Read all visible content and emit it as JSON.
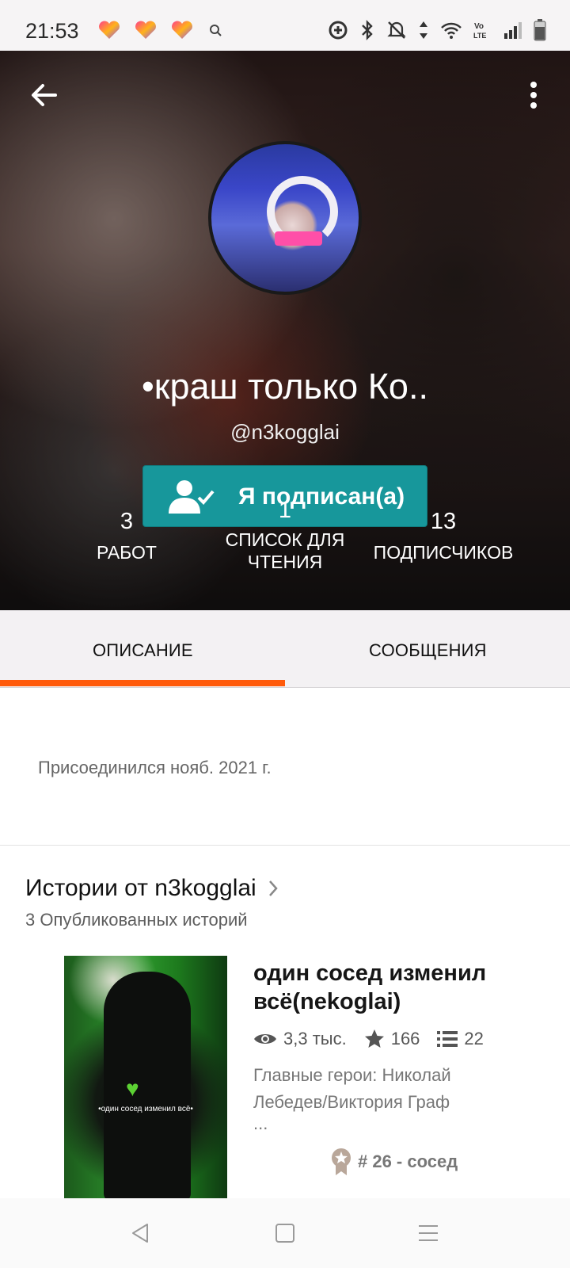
{
  "status_bar": {
    "time": "21:53",
    "app_icons": [
      "likee-heart-icon",
      "likee-heart-icon",
      "likee-heart-icon",
      "search-icon"
    ],
    "system_icons": [
      "data-saver-icon",
      "bluetooth-icon",
      "mute-icon",
      "data-arrows-icon",
      "wifi-icon",
      "volte-icon",
      "signal-icon",
      "battery-icon"
    ]
  },
  "profile": {
    "display_name": "•краш только Ко..",
    "handle": "@n3kogglai",
    "follow_button_label": "Я подписан(а)",
    "stats": [
      {
        "value": "3",
        "label": "РАБОТ"
      },
      {
        "value": "1",
        "label_line1": "СПИСОК ДЛЯ",
        "label_line2": "ЧТЕНИЯ"
      },
      {
        "value": "13",
        "label": "ПОДПИСЧИКОВ"
      }
    ]
  },
  "tabs": [
    {
      "label": "ОПИСАНИЕ",
      "active": true
    },
    {
      "label": "СООБЩЕНИЯ",
      "active": false
    }
  ],
  "about": {
    "joined": "Присоединился нояб. 2021 г."
  },
  "stories_section": {
    "title": "Истории от n3kogglai",
    "subtitle": "3 Опубликованных историй",
    "story": {
      "title": "один сосед изменил всё(nekoglai)",
      "cover_text": "•один сосед изменил всё•",
      "reads": "3,3 тыс.",
      "votes": "166",
      "parts": "22",
      "description_line1": "Главные герои: Николай",
      "description_line2": "Лебедев/Виктория Граф",
      "description_line3": "...",
      "rank": "# 26 - сосед"
    }
  },
  "colors": {
    "accent_orange": "#ff5a0a",
    "follow_teal": "#17979b"
  }
}
